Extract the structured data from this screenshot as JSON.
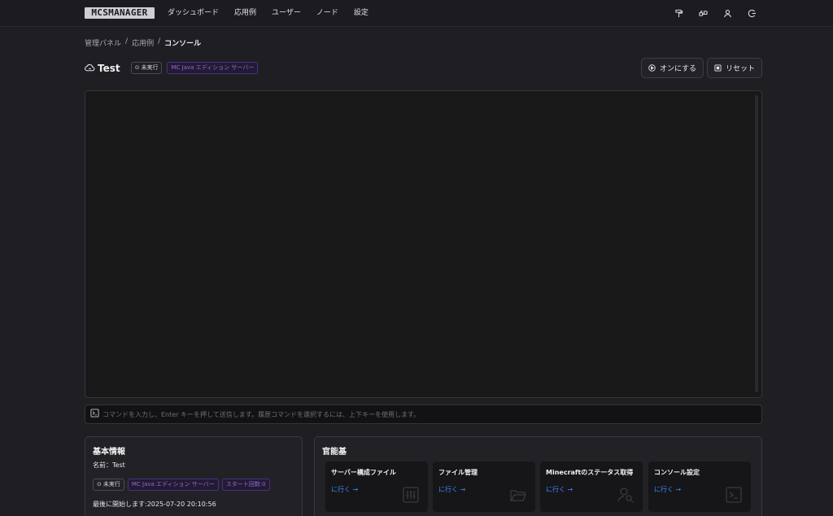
{
  "app": {
    "logo": "MCSMANAGER"
  },
  "nav": {
    "items": [
      "ダッシュボード",
      "応用例",
      "ユーザー",
      "ノード",
      "設定"
    ]
  },
  "top_icons": [
    "paint-roller-icon",
    "api-icon",
    "user-icon",
    "logout-icon"
  ],
  "breadcrumb": {
    "items": [
      "管理パネル",
      "応用例",
      "コンソール"
    ],
    "separator": "/"
  },
  "instance": {
    "name": "Test",
    "status": "未実行",
    "type": "MC Java エディション サーバー"
  },
  "actions": {
    "start": "オンにする",
    "reset": "リセット"
  },
  "command": {
    "placeholder": "コマンドを入力し、Enter キーを押して送信します。履歴コマンドを選択するには、上下キーを使用します。"
  },
  "basic_info": {
    "title": "基本情報",
    "name_line": "名前：Test",
    "status": "未実行",
    "type": "MC Java エディション サーバー",
    "start_count": "スタート回数:0",
    "last_start": "最後に開始します:2025-07-20 20:10:56"
  },
  "features": {
    "title": "官能基",
    "items": [
      {
        "title": "サーバー構成ファイル",
        "link": "に行く →"
      },
      {
        "title": "ファイル管理",
        "link": "に行く →"
      },
      {
        "title": "Minecraftのステータス取得",
        "link": "に行く →"
      },
      {
        "title": "コンソール設定",
        "link": "に行く →"
      }
    ]
  },
  "colors": {
    "link": "#3f8bff",
    "purple_tag": "#8f6ad7",
    "background": "#1f1f23"
  }
}
